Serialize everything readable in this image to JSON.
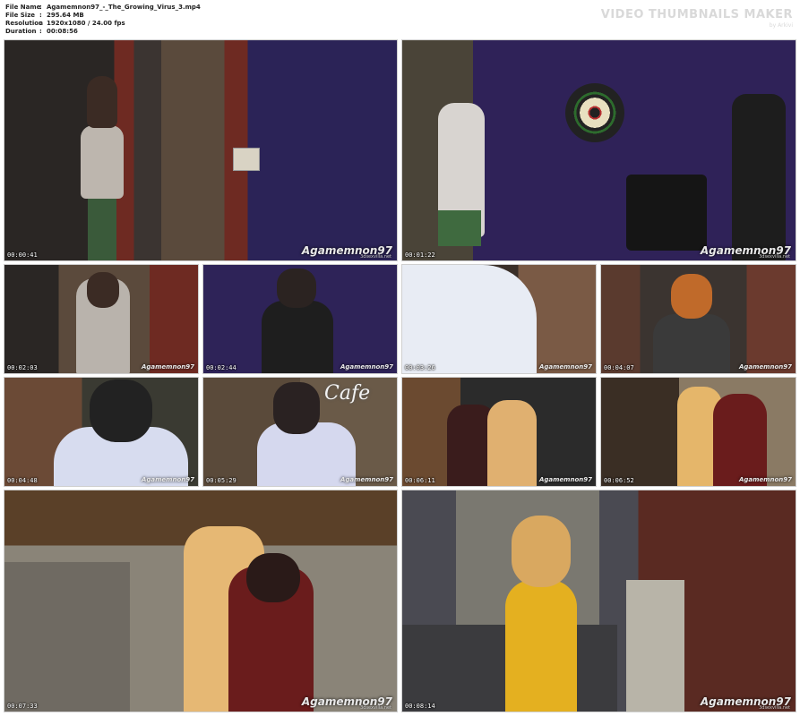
{
  "file_info": {
    "name_label": "File Name",
    "name_value": "Agamemnon97_-_The_Growing_Virus_3.mp4",
    "size_label": "File Size",
    "size_value": "295.64 MB",
    "resolution_label": "Resolution",
    "resolution_value": "1920x1080 / 24.00 fps",
    "duration_label": "Duration",
    "duration_value": "00:08:56",
    "separator": ":"
  },
  "brand": {
    "title": "VIDEO THUMBNAILS MAKER",
    "subtitle": "by Arkivi"
  },
  "watermark": {
    "text": "Agamemnon97",
    "subtext": "3dsexvilla.net"
  },
  "thumbnails": [
    {
      "timestamp": "00:00:41"
    },
    {
      "timestamp": "00:01:22"
    },
    {
      "timestamp": "00:02:03"
    },
    {
      "timestamp": "00:02:44"
    },
    {
      "timestamp": "00:03:26"
    },
    {
      "timestamp": "00:04:07"
    },
    {
      "timestamp": "00:04:48"
    },
    {
      "timestamp": "00:05:29"
    },
    {
      "timestamp": "00:06:11"
    },
    {
      "timestamp": "00:06:52"
    },
    {
      "timestamp": "00:07:33"
    },
    {
      "timestamp": "00:08:14"
    }
  ],
  "scene_text": {
    "cafe": "Cafe"
  }
}
